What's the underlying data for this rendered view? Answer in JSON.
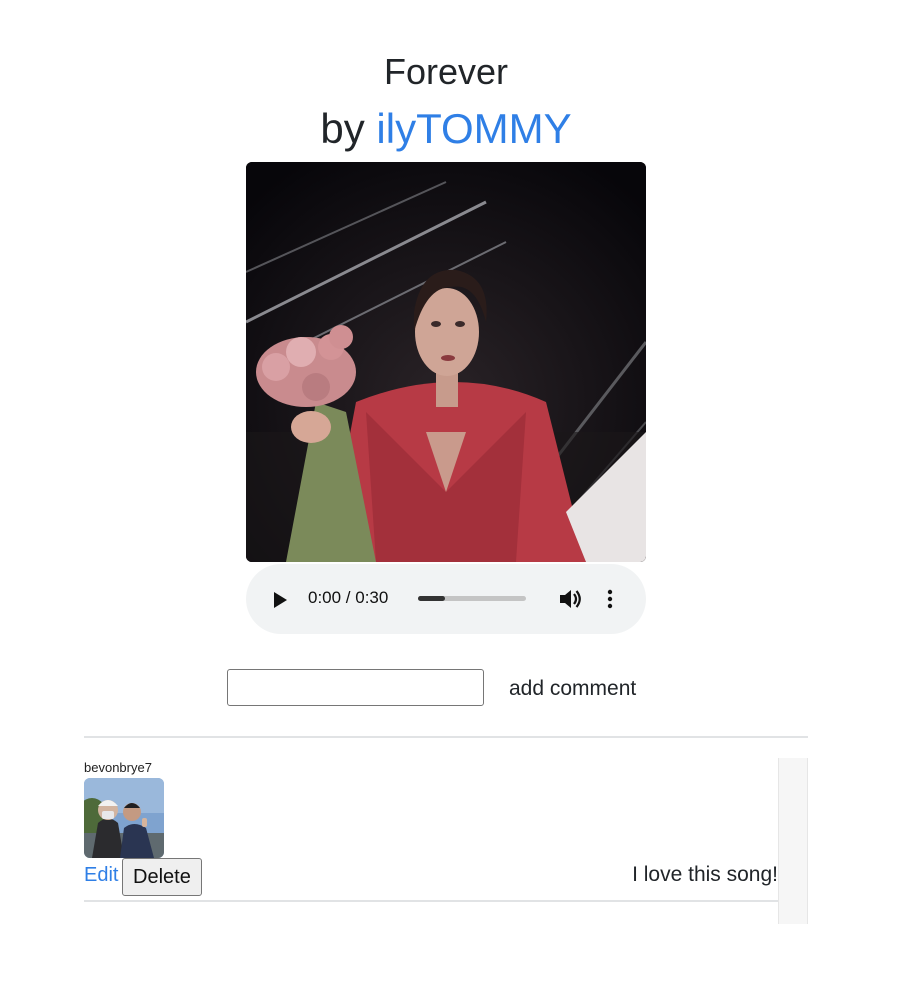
{
  "song": {
    "title": "Forever",
    "by_prefix": "by ",
    "artist": "ilyTOMMY"
  },
  "player": {
    "time": "0:00 / 0:30",
    "progress": 0.25
  },
  "comment_form": {
    "input_value": "",
    "submit_label": "add comment"
  },
  "comments": [
    {
      "username": "bevonbrye7",
      "edit_label": "Edit",
      "delete_label": "Delete",
      "text": "I love this song!"
    }
  ]
}
